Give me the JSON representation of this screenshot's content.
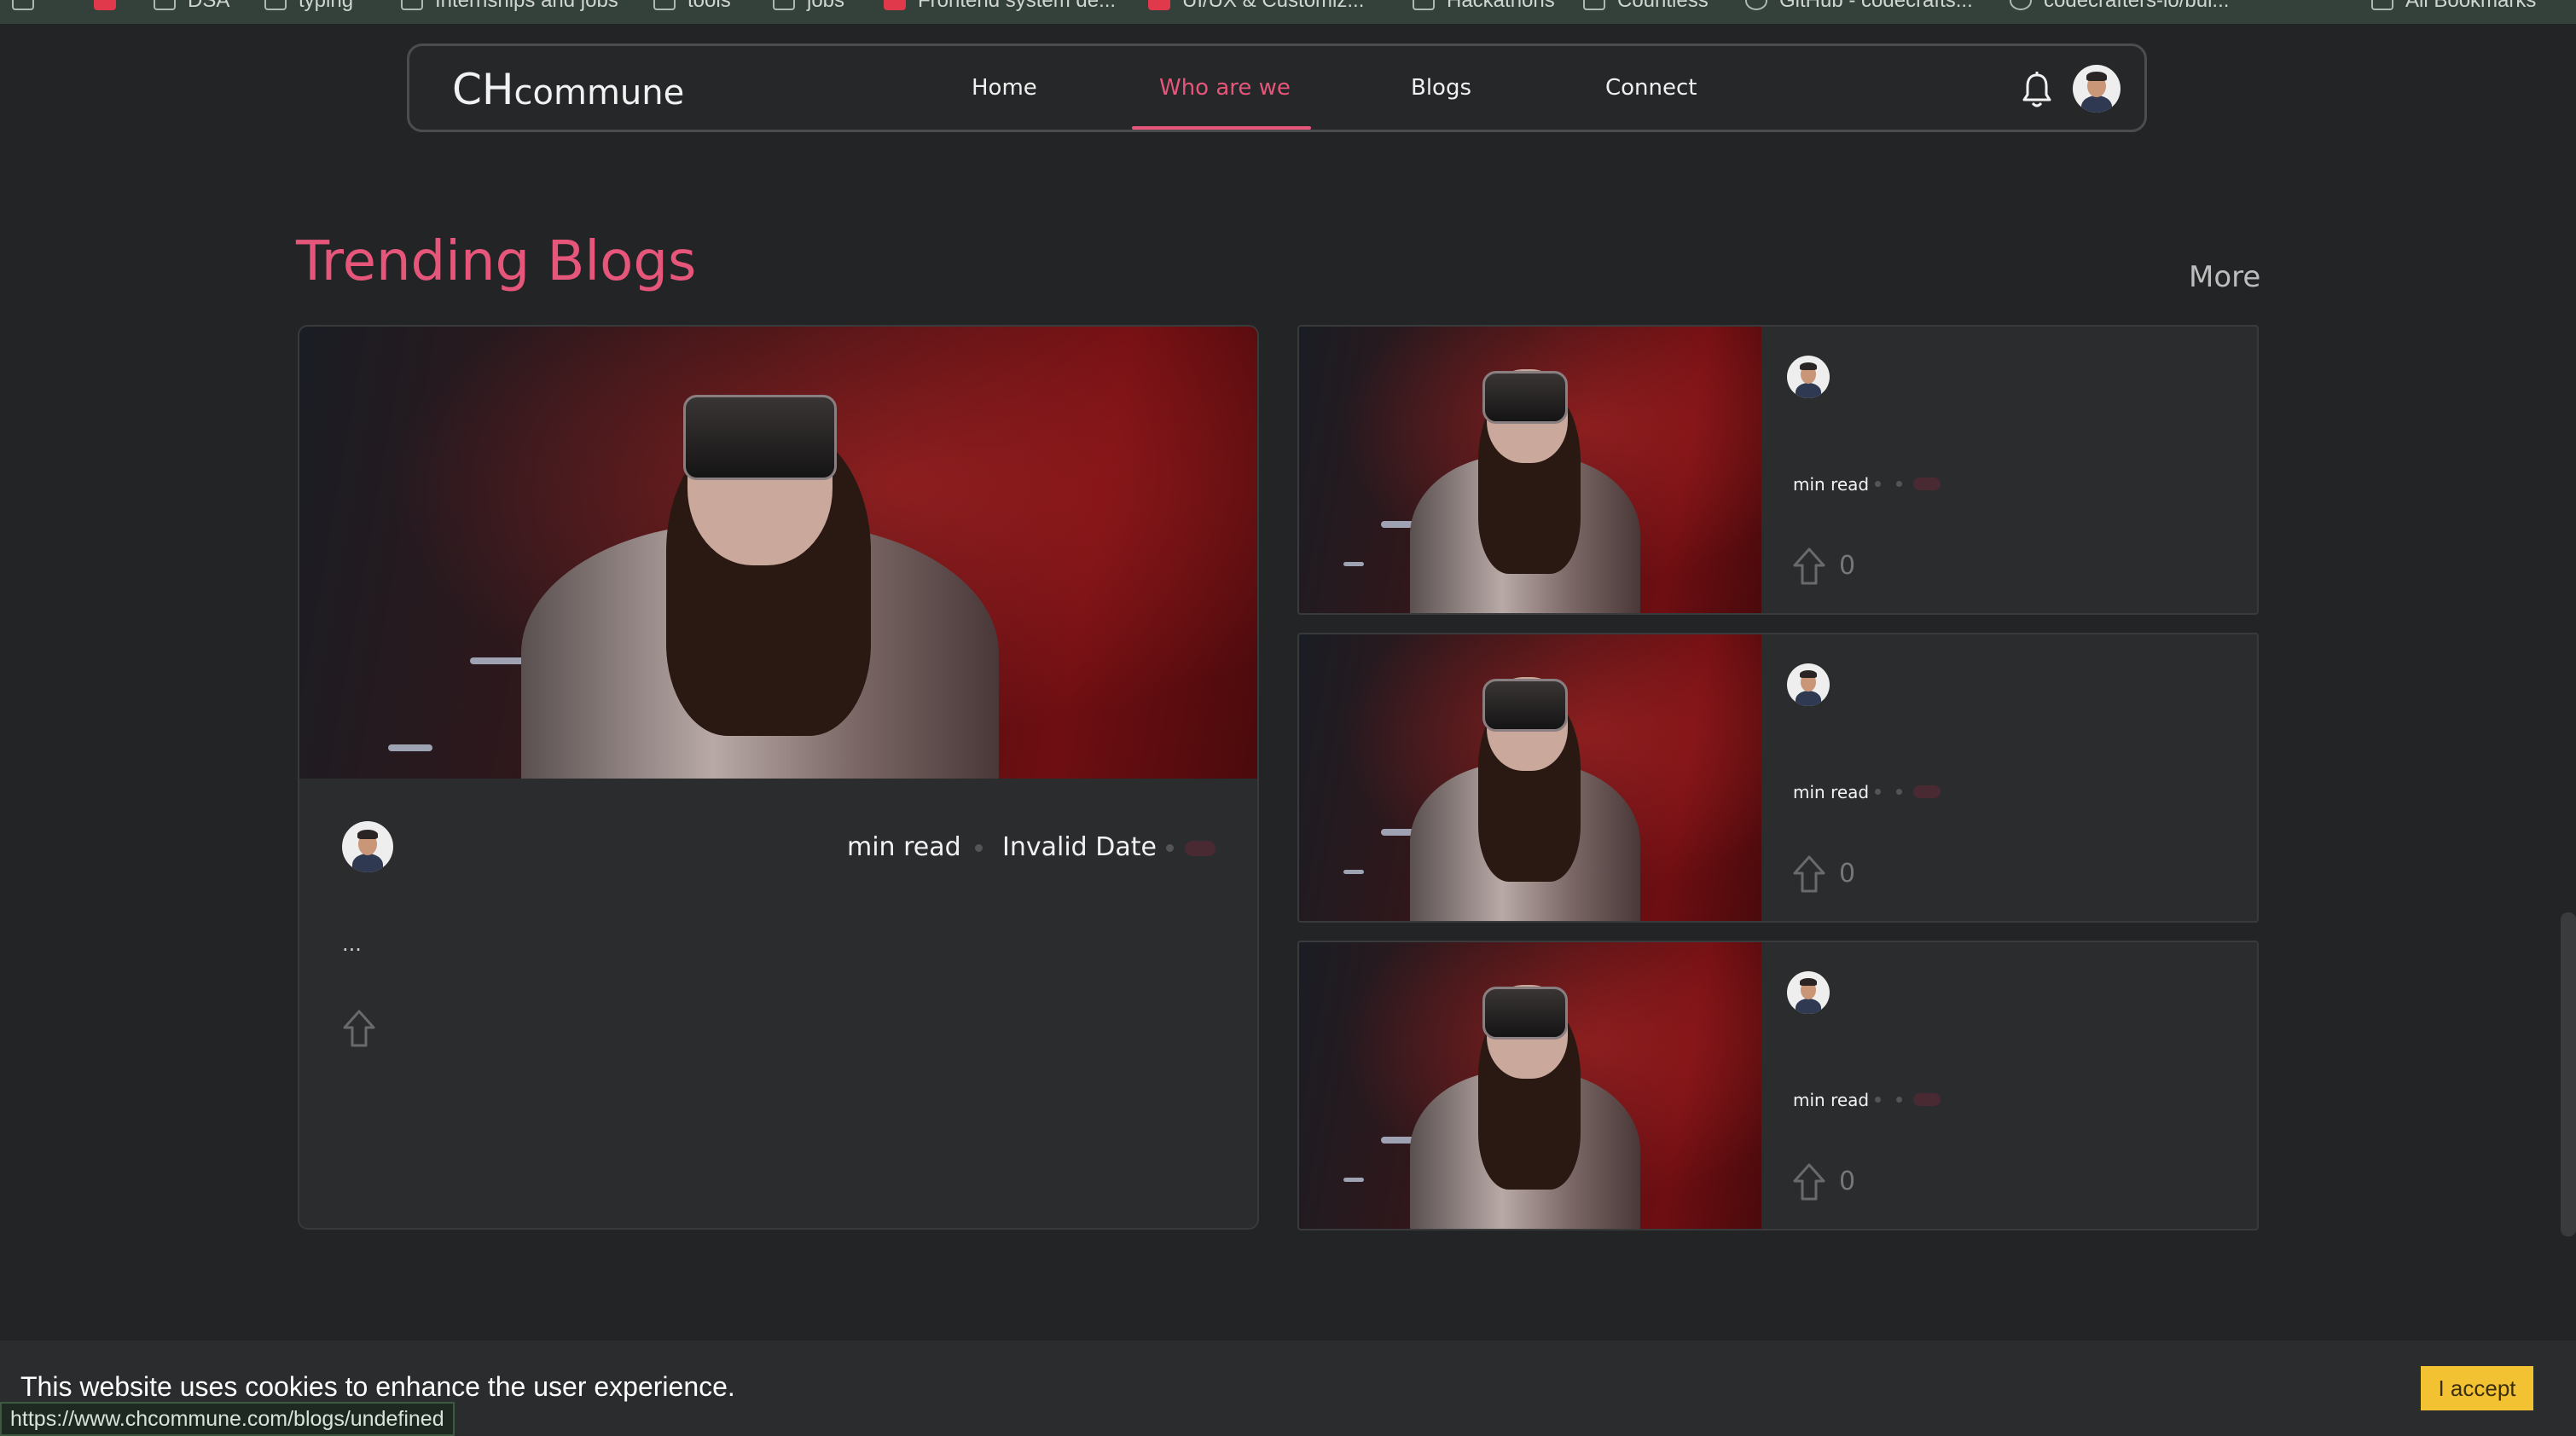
{
  "bookmarks": [
    {
      "label": "DSA",
      "icon": "folder-icon"
    },
    {
      "label": "typing",
      "icon": "folder-icon"
    },
    {
      "label": "Internships and jobs",
      "icon": "folder-icon"
    },
    {
      "label": "tools",
      "icon": "folder-icon"
    },
    {
      "label": "jobs",
      "icon": "folder-icon"
    },
    {
      "label": "Frontend system de...",
      "icon": "site-icon"
    },
    {
      "label": "UI/UX & Customiz...",
      "icon": "site-icon"
    },
    {
      "label": "Hackathons",
      "icon": "folder-icon"
    },
    {
      "label": "Countless",
      "icon": "folder-icon"
    },
    {
      "label": "GitHub - codecrafts...",
      "icon": "github-icon"
    },
    {
      "label": "codecrafters-io/bui...",
      "icon": "github-icon"
    },
    {
      "label": "All Bookmarks",
      "icon": "folder-icon"
    }
  ],
  "nav": {
    "logo_big": "CH",
    "logo_small": "commune",
    "links": [
      "Home",
      "Who are we",
      "Blogs",
      "Connect"
    ],
    "active": "Who are we"
  },
  "section": {
    "title": "Trending Blogs",
    "more": "More"
  },
  "featured": {
    "read_label": "min read",
    "date": "Invalid Date",
    "excerpt": "...",
    "upvotes": ""
  },
  "side_posts": [
    {
      "read_label": "min read",
      "upvotes": "0"
    },
    {
      "read_label": "min read",
      "upvotes": "0"
    },
    {
      "read_label": "min read",
      "upvotes": "0"
    }
  ],
  "cookie": {
    "message": "This website uses cookies to enhance the user experience.",
    "accept": "I accept"
  },
  "status_url": "https://www.chcommune.com/blogs/undefined",
  "colors": {
    "accent": "#e5567a",
    "background": "#232425",
    "card": "#2b2c2d",
    "accept_button": "#f3c232"
  }
}
